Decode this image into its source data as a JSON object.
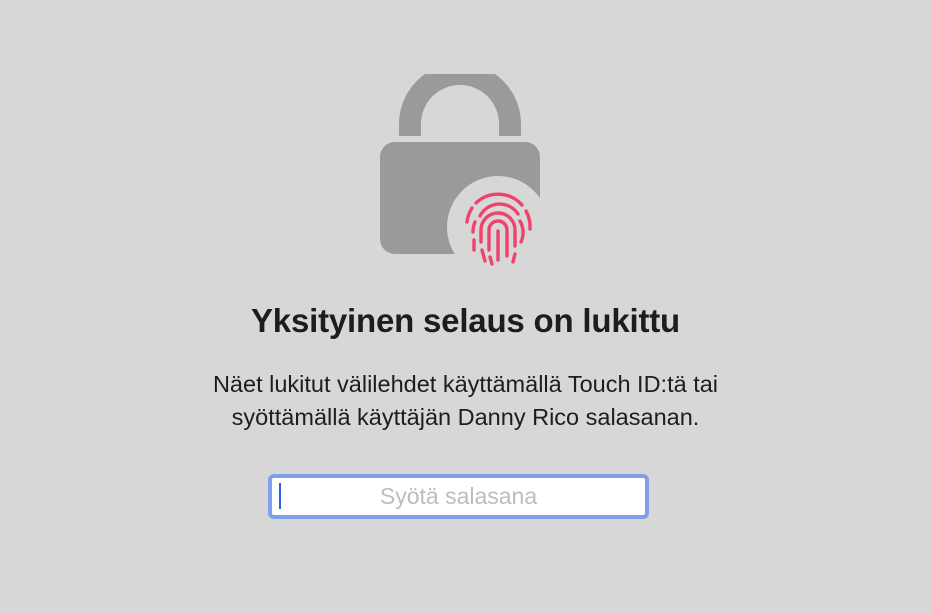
{
  "lock_screen": {
    "title": "Yksityinen selaus on lukittu",
    "message_line1": "Näet lukitut välilehdet käyttämällä Touch ID:tä tai",
    "message_line2": "syöttämällä käyttäjän Danny Rico salasanan.",
    "password_placeholder": "Syötä salasana",
    "password_value": ""
  },
  "icons": {
    "lock": "lock-icon",
    "fingerprint": "fingerprint-icon"
  },
  "colors": {
    "background": "#d7d7d7",
    "lock": "#9a9a9a",
    "fingerprint": "#f0436b",
    "focus_ring": "#7f9fe6"
  }
}
